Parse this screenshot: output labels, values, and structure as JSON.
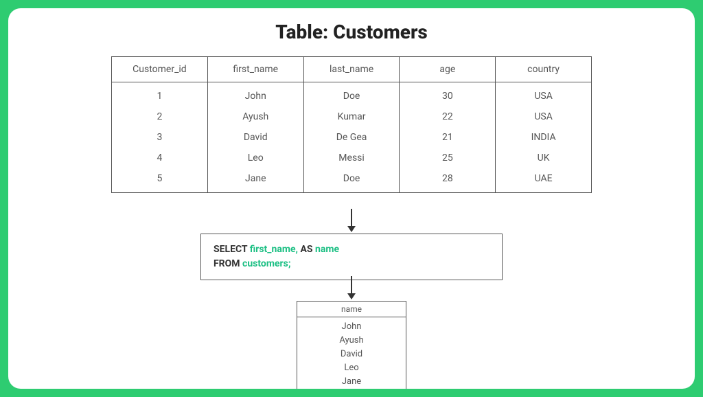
{
  "title": "Table: Customers",
  "customers": {
    "columns": [
      "Customer_id",
      "first_name",
      "last_name",
      "age",
      "country"
    ],
    "rows": [
      [
        "1",
        "John",
        "Doe",
        "30",
        "USA"
      ],
      [
        "2",
        "Ayush",
        "Kumar",
        "22",
        "USA"
      ],
      [
        "3",
        "David",
        "De Gea",
        "21",
        "INDIA"
      ],
      [
        "4",
        "Leo",
        "Messi",
        "25",
        "UK"
      ],
      [
        "5",
        "Jane",
        "Doe",
        "28",
        "UAE"
      ]
    ]
  },
  "sql": {
    "kw_select": "SELECT",
    "col1": "first_name,",
    "kw_as": "AS",
    "alias": "name",
    "kw_from": "FROM",
    "table": "customers;"
  },
  "result": {
    "header": "name",
    "rows": [
      "John",
      "Ayush",
      "David",
      "Leo",
      "Jane"
    ]
  }
}
